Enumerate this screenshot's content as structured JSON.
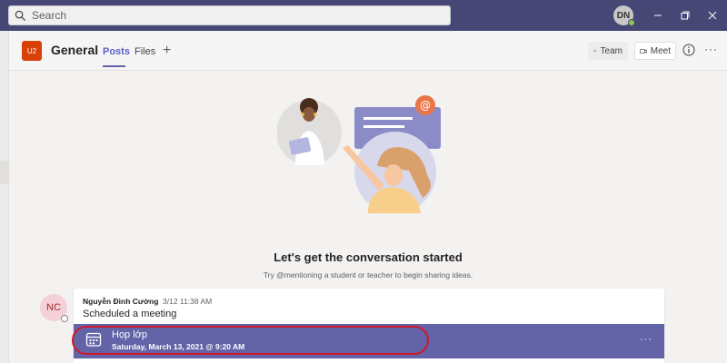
{
  "topbar": {
    "search_placeholder": "Search",
    "user_initials": "DN"
  },
  "channel": {
    "team_abbrev": "U2",
    "name": "General",
    "tabs": [
      {
        "label": "Posts",
        "active": true
      },
      {
        "label": "Files",
        "active": false
      }
    ],
    "add_tab_label": "+",
    "team_button_label": "Team",
    "meet_button_label": "Meet"
  },
  "empty_state": {
    "title": "Let's get the conversation started",
    "subtitle": "Try @mentioning a student or teacher to begin sharing ideas."
  },
  "post": {
    "author_initials": "NC",
    "author": "Nguyễn Đình Cường",
    "timestamp": "3/12 11:38 AM",
    "body": "Scheduled a meeting",
    "meeting": {
      "title": "Họp lớp",
      "date": "Saturday, March 13, 2021 @ 9:20 AM",
      "more_label": "···"
    }
  },
  "colors": {
    "topbar": "#464775",
    "accent": "#6264a7",
    "team_icon": "#d74108",
    "highlight": "#d0182a"
  }
}
